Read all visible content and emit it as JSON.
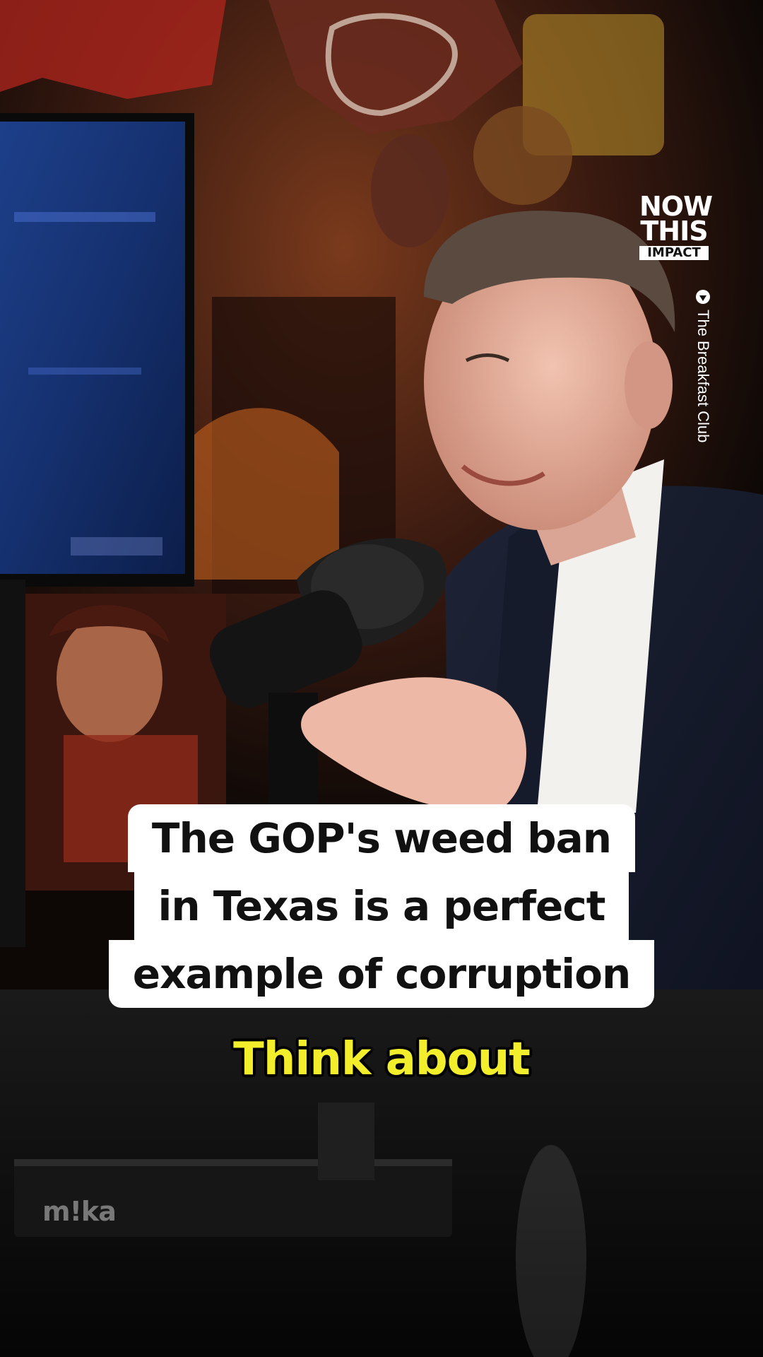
{
  "logo": {
    "line1": "NOW",
    "line2": "THIS",
    "line3": "IMPACT"
  },
  "credit": {
    "text": "The Breakfast Club"
  },
  "caption": {
    "lines": [
      "The GOP's weed ban",
      "in Texas is a perfect",
      "example of corruption"
    ]
  },
  "subtitle": {
    "text": "Think about"
  },
  "desk_brand": {
    "text": "m!ka"
  },
  "colors": {
    "subtitle": "#f2ee2c",
    "caption_bg": "#ffffff"
  }
}
